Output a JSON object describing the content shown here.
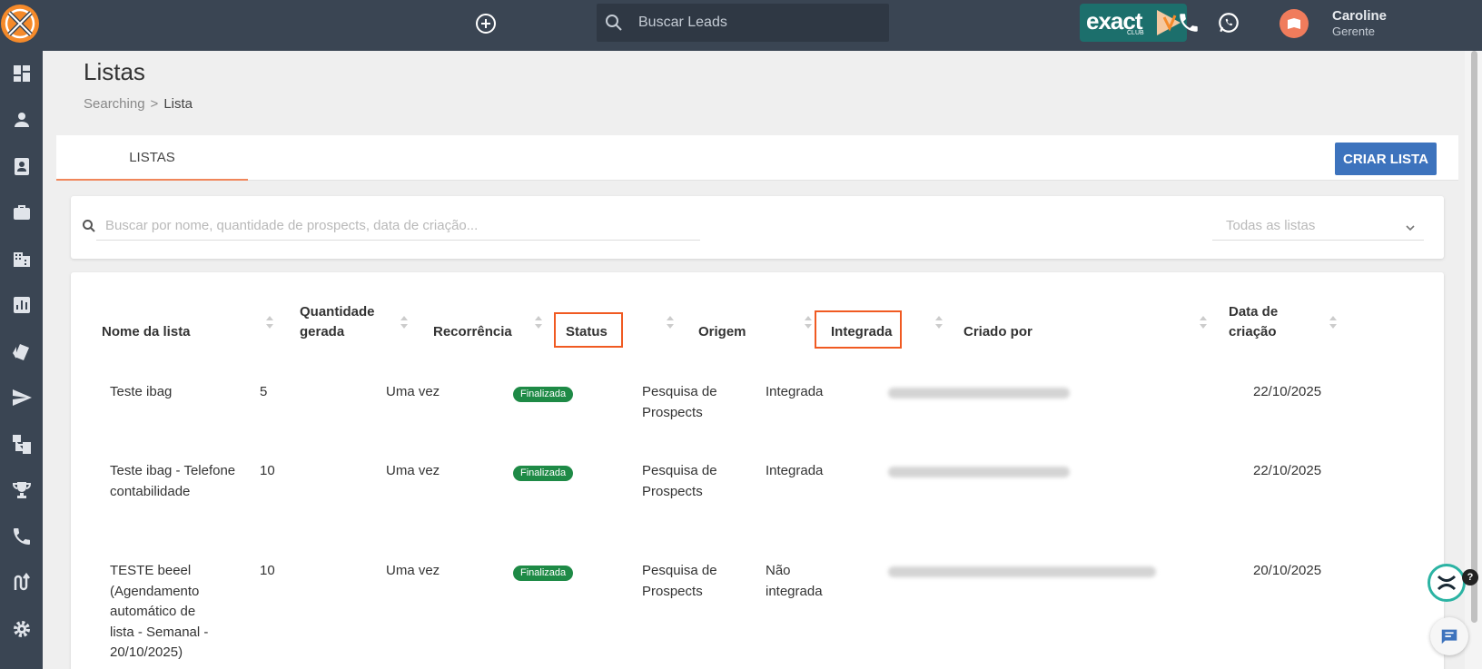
{
  "topbar": {
    "search_placeholder": "Buscar Leads",
    "brand_word": "exact",
    "brand_sub": "CLUB",
    "user_name": "Caroline",
    "user_role": "Gerente"
  },
  "header": {
    "title": "Listas",
    "breadcrumb": [
      "Searching",
      ">",
      "Lista"
    ]
  },
  "tabs": [
    {
      "label": "LISTAS"
    }
  ],
  "toolbar": {
    "create_label": "CRIAR LISTA"
  },
  "filter": {
    "search_placeholder": "Buscar por nome, quantidade de prospects, data de criação...",
    "select_value": "Todas as listas"
  },
  "table": {
    "columns": [
      {
        "label": "Nome da lista"
      },
      {
        "label": "Quantidade gerada"
      },
      {
        "label": "Recorrência"
      },
      {
        "label": "Status"
      },
      {
        "label": "Origem"
      },
      {
        "label": "Integrada"
      },
      {
        "label": "Criado por"
      },
      {
        "label": "Data de criação"
      }
    ],
    "rows": [
      {
        "name": "Teste ibag",
        "quantity": "5",
        "recurrence": "Uma vez",
        "status": "Finalizada",
        "origin": "Pesquisa de Prospects",
        "integrated": "Integrada",
        "date": "22/10/2025"
      },
      {
        "name": "Teste ibag - Telefone contabilidade",
        "quantity": "10",
        "recurrence": "Uma vez",
        "status": "Finalizada",
        "origin": "Pesquisa de Prospects",
        "integrated": "Integrada",
        "date": "22/10/2025"
      },
      {
        "name": "TESTE beeel (Agendamento automático de lista - Semanal - 20/10/2025)",
        "quantity": "10",
        "recurrence": "Uma vez",
        "status": "Finalizada",
        "origin": "Pesquisa de Prospects",
        "integrated": "Não integrada",
        "date": "20/10/2025"
      }
    ]
  },
  "help": {
    "badge": "?"
  },
  "colors": {
    "topbar": "#3a4553",
    "accent": "#f0865a",
    "primary_button": "#3d73bd",
    "status_green": "#1e8a46",
    "highlight": "#f05a22"
  }
}
